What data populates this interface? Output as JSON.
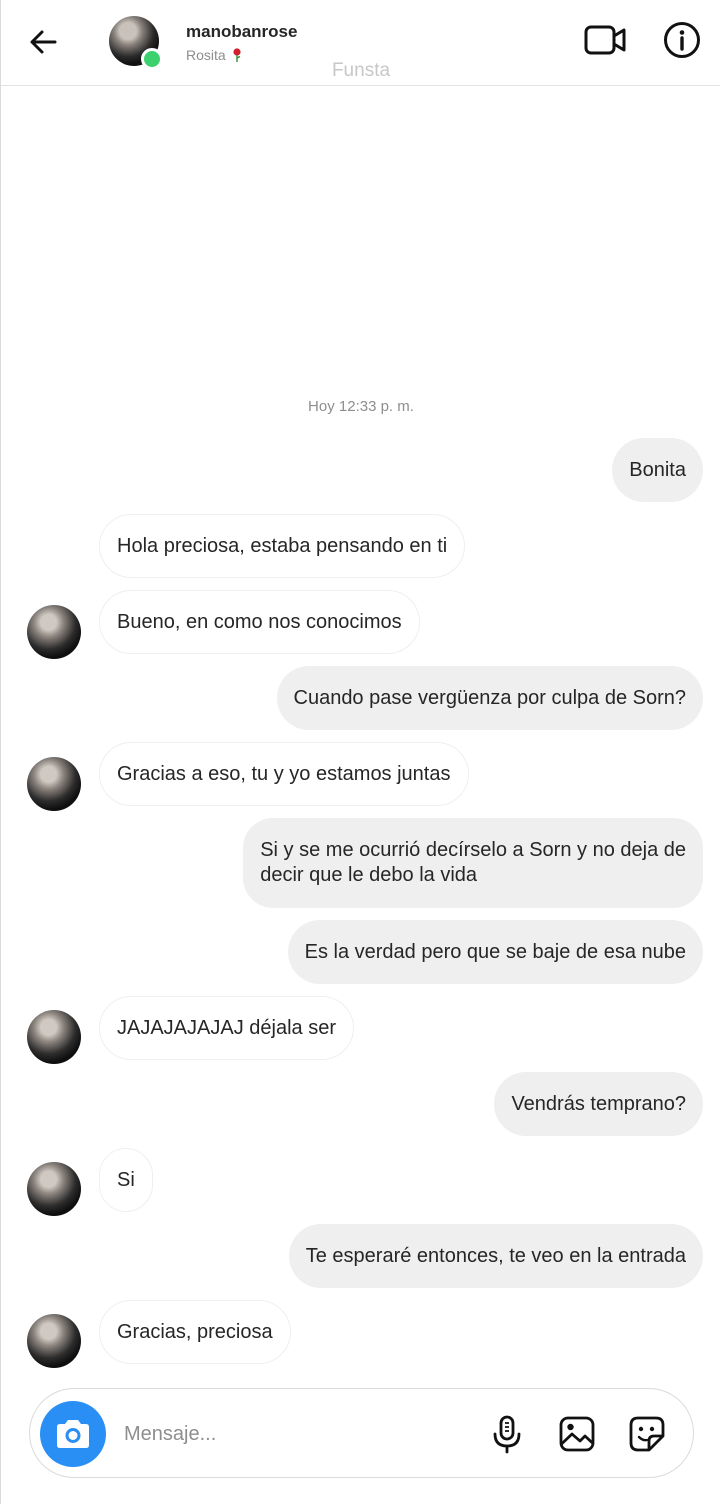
{
  "header": {
    "username": "manobanrose",
    "subtitle": "Rosita",
    "subtitle_emoji": "rose-emoji",
    "watermark": "Funsta",
    "icons": [
      "back-arrow-icon",
      "video-camera-icon",
      "info-icon"
    ]
  },
  "chat": {
    "timestamp": "Hoy 12:33 p. m.",
    "messages": [
      {
        "from": "me",
        "text": "Bonita"
      },
      {
        "from": "them",
        "text": "Hola preciosa, estaba pensando en ti"
      },
      {
        "from": "them",
        "text": "Bueno, en como nos conocimos"
      },
      {
        "from": "me",
        "text": "Cuando pase vergüenza por culpa de Sorn?"
      },
      {
        "from": "them",
        "text": "Gracias a eso, tu y yo estamos juntas"
      },
      {
        "from": "me",
        "line1": "Si y se me ocurrió decírselo a Sorn y no deja de",
        "line2": "decir que le debo la vida"
      },
      {
        "from": "me",
        "text": "Es la verdad pero que se baje de esa nube"
      },
      {
        "from": "them",
        "text": "JAJAJAJAJAJ déjala ser"
      },
      {
        "from": "me",
        "text": "Vendrás temprano?"
      },
      {
        "from": "them",
        "text": "Si"
      },
      {
        "from": "me",
        "text": "Te esperaré entonces, te veo en la entrada"
      },
      {
        "from": "them",
        "text": "Gracias, preciosa"
      }
    ]
  },
  "composer": {
    "placeholder": "Mensaje...",
    "icons": [
      "camera-icon",
      "microphone-icon",
      "gallery-icon",
      "sticker-icon"
    ]
  },
  "colors": {
    "accent_blue": "#2a8ff5",
    "online_green": "#3bd16f",
    "sent_bubble": "#efefef",
    "muted_text": "#8e8e8e"
  }
}
